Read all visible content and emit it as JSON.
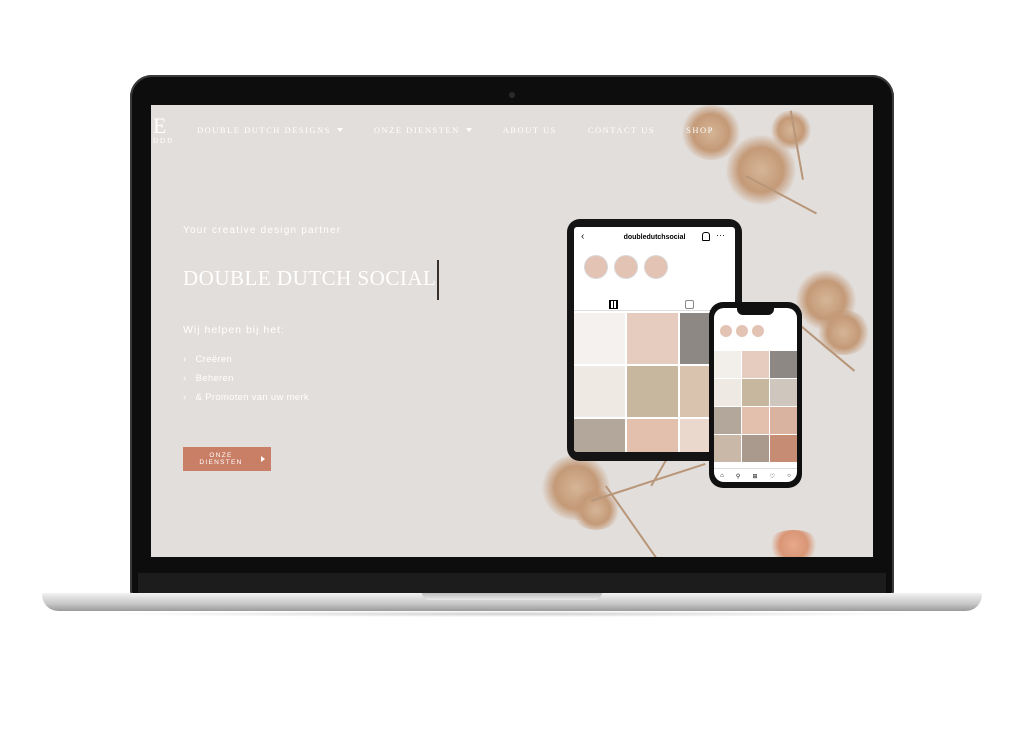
{
  "logo": {
    "letter": "E",
    "sub": "DDD"
  },
  "nav": {
    "items": [
      {
        "label": "DOUBLE DUTCH DESIGNS",
        "has_dropdown": true
      },
      {
        "label": "ONZE DIENSTEN",
        "has_dropdown": true
      },
      {
        "label": "ABOUT US",
        "has_dropdown": false
      },
      {
        "label": "CONTACT US",
        "has_dropdown": false
      },
      {
        "label": "SHOP",
        "has_dropdown": false
      }
    ]
  },
  "hero": {
    "tagline": "Your creative design partner",
    "headline": "DOUBLE DUTCH SOCIAL",
    "intro": "Wij helpen bij het:",
    "list": [
      "Creëren",
      "Beheren",
      "& Promoten van uw merk"
    ],
    "cta_label": "ONZE DIENSTEN"
  },
  "tablet": {
    "username": "doubledutchsocial"
  },
  "colors": {
    "background": "#e2dedb",
    "accent": "#c97f66",
    "text": "#ffffff"
  },
  "icons": [
    "chevron-right-icon",
    "caret-down-icon",
    "back-arrow-icon",
    "bell-icon",
    "more-icon",
    "grid-icon",
    "tagged-icon"
  ]
}
